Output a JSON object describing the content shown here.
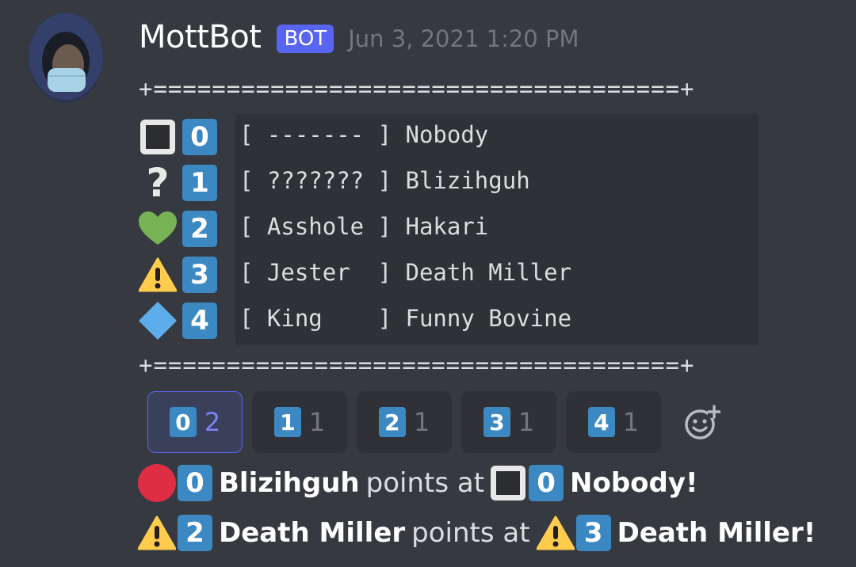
{
  "message": {
    "username": "MottBot",
    "bot_tag": "BOT",
    "timestamp": "Jun 3, 2021 1:20 PM",
    "separator": "+====================================+",
    "rows": [
      {
        "icon": "white-square-icon",
        "key": "0",
        "code": "[ ------- ] Nobody"
      },
      {
        "icon": "question-mark-icon",
        "key": "1",
        "code": "[ ??????? ] Blizihguh"
      },
      {
        "icon": "green-heart-icon",
        "key": "2",
        "code": "[ Asshole ] Hakari"
      },
      {
        "icon": "warning-icon",
        "key": "3",
        "code": "[ Jester  ] Death Miller"
      },
      {
        "icon": "blue-diamond-icon",
        "key": "4",
        "code": "[ King    ] Funny Bovine"
      }
    ]
  },
  "reactions": [
    {
      "emoji": "0",
      "count": "2",
      "active": true
    },
    {
      "emoji": "1",
      "count": "1",
      "active": false
    },
    {
      "emoji": "2",
      "count": "1",
      "active": false
    },
    {
      "emoji": "3",
      "count": "1",
      "active": false
    },
    {
      "emoji": "4",
      "count": "1",
      "active": false
    }
  ],
  "add_reaction_icon": "add-reaction-icon",
  "events": [
    {
      "actor_key": "0",
      "actor": "Blizihguh",
      "verb": "points at",
      "target_key": "0",
      "target": "Nobody",
      "end": "!"
    },
    {
      "actor_key": "2",
      "actor": "Death Miller",
      "verb": "points at",
      "target_key": "3",
      "target": "Death Miller",
      "end": "!"
    }
  ],
  "colors": {
    "background": "#36393f",
    "code_background": "#2f3136",
    "bot_tag": "#5865f2",
    "keycap": "#3b88c3",
    "timestamp": "#72767d"
  }
}
